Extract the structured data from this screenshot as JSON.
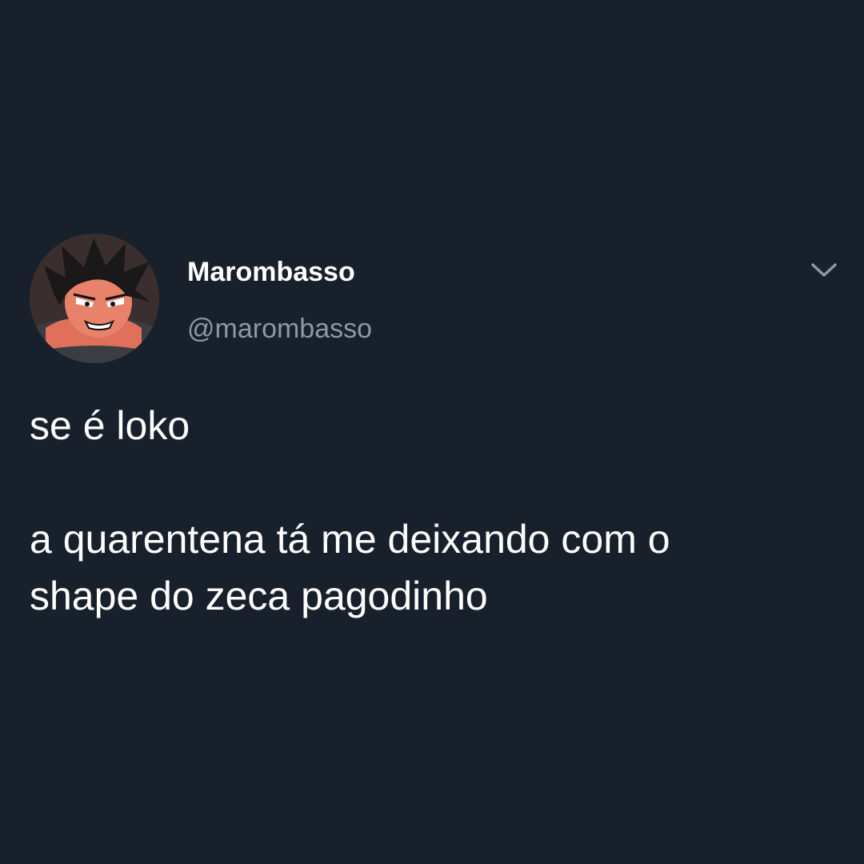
{
  "author": {
    "display_name": "Marombasso",
    "handle": "@marombasso",
    "avatar_icon": "anime-character-avatar"
  },
  "menu": {
    "icon": "chevron-down-icon"
  },
  "tweet": {
    "lines": [
      "se é loko",
      "",
      "a quarentena tá me deixando com o",
      "shape do zeca pagodinho"
    ]
  },
  "colors": {
    "background": "#18202b",
    "text": "#ffffff",
    "secondary_text": "#8b98a5"
  }
}
